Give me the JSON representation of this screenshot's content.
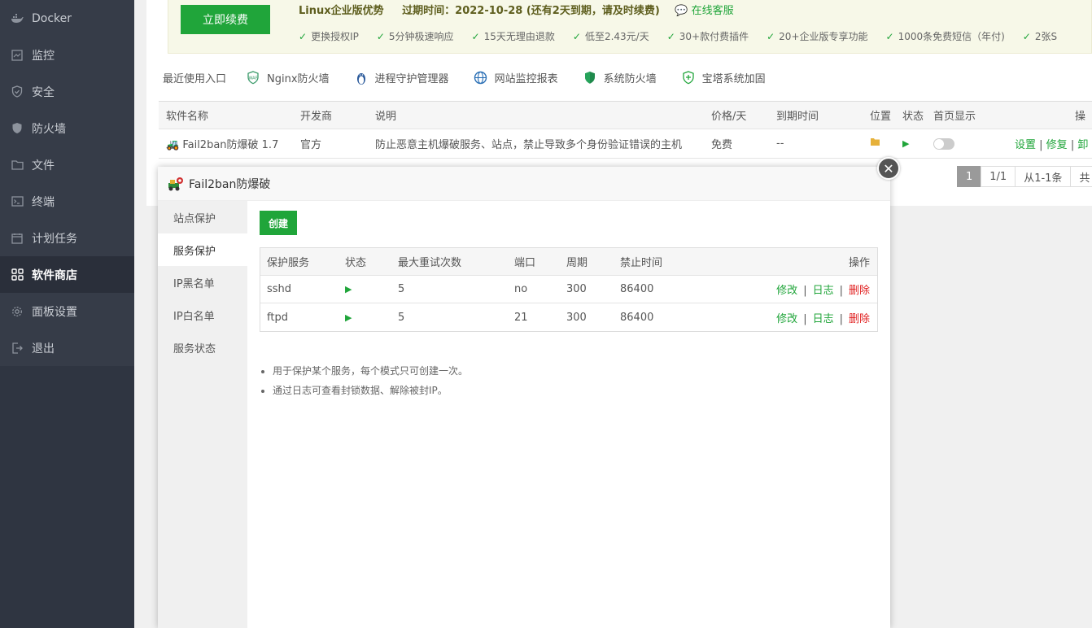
{
  "sidebar": {
    "items": [
      {
        "label": "Docker",
        "icon": "docker-icon"
      },
      {
        "label": "监控",
        "icon": "monitor-icon"
      },
      {
        "label": "安全",
        "icon": "shield-icon"
      },
      {
        "label": "防火墙",
        "icon": "firewall-icon"
      },
      {
        "label": "文件",
        "icon": "folder-icon"
      },
      {
        "label": "终端",
        "icon": "terminal-icon"
      },
      {
        "label": "计划任务",
        "icon": "calendar-icon"
      },
      {
        "label": "软件商店",
        "icon": "grid-icon"
      },
      {
        "label": "面板设置",
        "icon": "gear-icon"
      },
      {
        "label": "退出",
        "icon": "logout-icon"
      }
    ],
    "active_index": 7
  },
  "promo": {
    "renew_label": "立即续费",
    "title": "Linux企业版优势",
    "expire": "过期时间：2022-10-28 (还有2天到期，请及时续费)",
    "customer_service": "在线客服",
    "features": [
      "更换授权IP",
      "5分钟极速响应",
      "15天无理由退款",
      "低至2.43元/天",
      "30+款付费插件",
      "20+企业版专享功能",
      "1000条免费短信（年付)",
      "2张S"
    ]
  },
  "recent": {
    "label": "最近使用入口",
    "items": [
      "Nginx防火墙",
      "进程守护管理器",
      "网站监控报表",
      "系统防火墙",
      "宝塔系统加固"
    ]
  },
  "soft_table": {
    "headers": [
      "软件名称",
      "开发商",
      "说明",
      "价格/天",
      "到期时间",
      "位置",
      "状态",
      "首页显示",
      "操"
    ],
    "row": {
      "name": "Fail2ban防爆破 1.7",
      "vendor": "官方",
      "desc": "防止恶意主机爆破服务、站点，禁止导致多个身份验证错误的主机",
      "price": "免费",
      "expire": "--",
      "ops": [
        "设置",
        "修复",
        "卸"
      ]
    }
  },
  "pager": {
    "current": "1",
    "pages": "1/1",
    "range": "从1-1条",
    "total": "共"
  },
  "modal": {
    "title": "Fail2ban防爆破",
    "tabs": [
      "站点保护",
      "服务保护",
      "IP黑名单",
      "IP白名单",
      "服务状态"
    ],
    "active_tab": 1,
    "create_label": "创建",
    "headers": [
      "保护服务",
      "状态",
      "最大重试次数",
      "端口",
      "周期",
      "禁止时间",
      "操作"
    ],
    "rows": [
      {
        "service": "sshd",
        "retries": "5",
        "port": "no",
        "period": "300",
        "ban": "86400"
      },
      {
        "service": "ftpd",
        "retries": "5",
        "port": "21",
        "period": "300",
        "ban": "86400"
      }
    ],
    "ops": {
      "edit": "修改",
      "log": "日志",
      "del": "删除",
      "sep": "|"
    },
    "notes": [
      "用于保护某个服务，每个模式只可创建一次。",
      "通过日志可查看封锁数据、解除被封IP。"
    ]
  },
  "colors": {
    "accent": "#20a53a",
    "danger": "#e02020",
    "sidebar": "#2f3541"
  }
}
